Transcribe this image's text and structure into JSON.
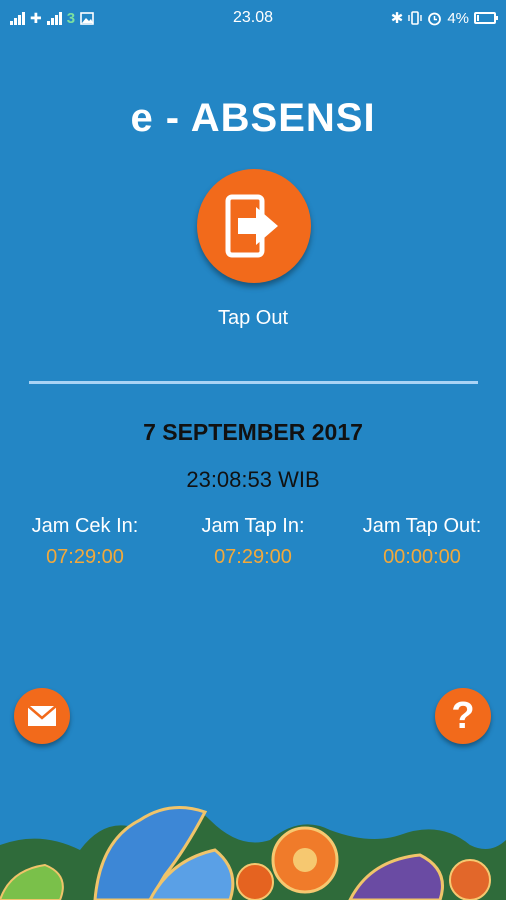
{
  "status_bar": {
    "time": "23.08",
    "battery_percent": "4%",
    "network_label": "3",
    "icons": [
      "signal-icon",
      "data-icon",
      "signal-icon",
      "network-3-icon",
      "image-icon",
      "bluetooth-icon",
      "vibrate-icon",
      "alarm-icon",
      "battery-icon"
    ]
  },
  "app": {
    "title": "e - ABSENSI"
  },
  "tap": {
    "label": "Tap Out",
    "icon": "exit-icon"
  },
  "info": {
    "date": "7 SEPTEMBER 2017",
    "time": "23:08:53 WIB"
  },
  "records": [
    {
      "label": "Jam Cek In:",
      "value": "07:29:00"
    },
    {
      "label": "Jam Tap In:",
      "value": "07:29:00"
    },
    {
      "label": "Jam Tap Out:",
      "value": "00:00:00"
    }
  ],
  "actions": {
    "mail_icon": "mail-icon",
    "help_icon": "help-icon",
    "help_glyph": "?"
  },
  "colors": {
    "background": "#2386c5",
    "accent": "#f26a1b",
    "value_text": "#f2a93b",
    "divider": "#a9d3f5"
  }
}
